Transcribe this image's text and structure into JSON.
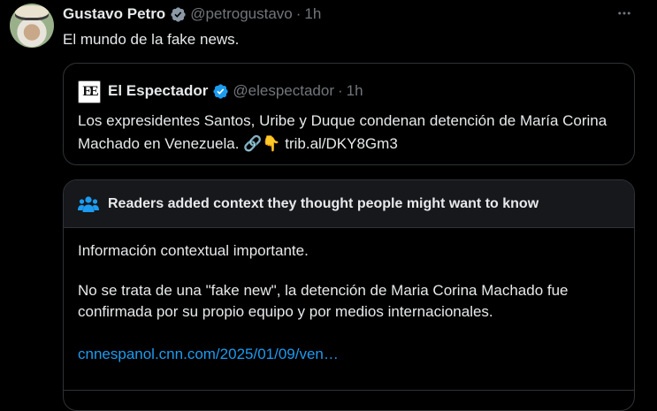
{
  "tweet": {
    "author_name": "Gustavo Petro",
    "handle": "@petrogustavo",
    "separator": "·",
    "time": "1h",
    "text": "El mundo de la fake news.",
    "more_icon": "more-dots-icon"
  },
  "quote": {
    "logo_text": "EE",
    "author_name": "El Espectador",
    "handle": "@elespectador",
    "separator": "·",
    "time": "1h",
    "text_main": "Los expresidentes Santos, Uribe y Duque condenan detención de María Corina Machado en Venezuela.",
    "emoji": "🔗👇",
    "link": "trib.al/DKY8Gm3"
  },
  "context_note": {
    "icon": "people-icon",
    "title": "Readers added context they thought people might want to know",
    "p1": "Información contextual importante.",
    "p2": "No se trata de una \"fake new\", la detención de Maria Corina Machado fue confirmada por su propio equipo y por medios internacionales.",
    "link": "cnnespanol.cnn.com/2025/01/09/ven…"
  },
  "colors": {
    "background": "#000000",
    "text": "#e7e9ea",
    "muted": "#71767b",
    "border": "#2f3336",
    "accent": "#1d9bf0"
  }
}
